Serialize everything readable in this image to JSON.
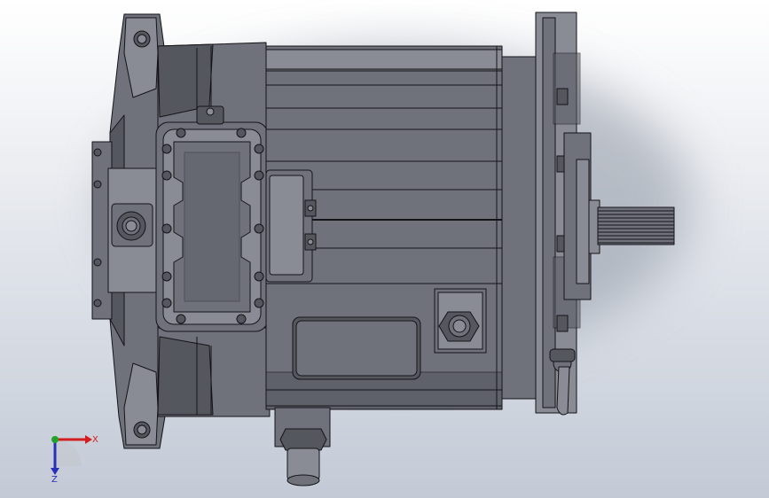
{
  "viewport": {
    "background_top": "#ffffff",
    "background_bottom": "#c3cad6",
    "shadow_color": "#8d95a3"
  },
  "model": {
    "body_color": "#6f717b",
    "body_light": "#8a8c95",
    "body_dark": "#55575f",
    "edge_color": "#141418"
  },
  "triad": {
    "x_label": "X",
    "z_label": "Z",
    "x_color": "#d21e1e",
    "y_color": "#1fa52a",
    "z_color": "#2631b8"
  }
}
